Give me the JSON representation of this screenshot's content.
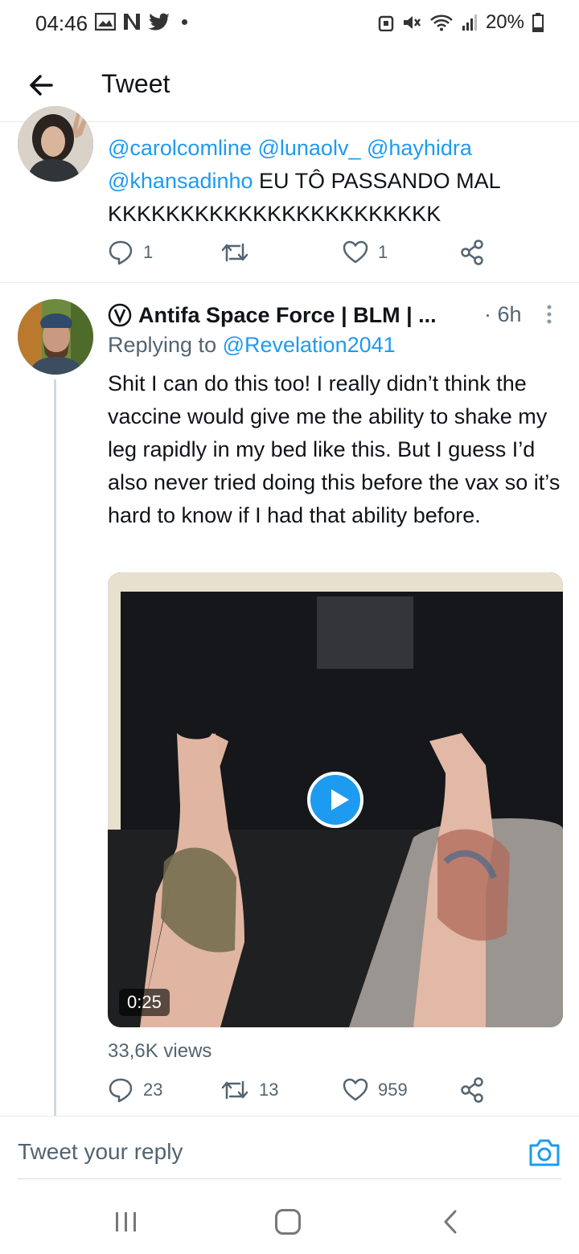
{
  "status_bar": {
    "time": "04:46",
    "battery": "20%"
  },
  "header": {
    "title": "Tweet"
  },
  "tweet1": {
    "mentions_line1": "@carolcomline @lunaolv_ @hayhidra",
    "mention_line2": "@khansadinho",
    "text_line2": " EU TÔ PASSANDO MAL",
    "text_line3": "KKKKKKKKKKKKKKKKKKKKKKK",
    "reply_count": "1",
    "like_count": "1"
  },
  "tweet2": {
    "author_name": "Antifa Space Force | BLM | ...",
    "time": "· 6h",
    "replying_prefix": "Replying to ",
    "replying_to": "@Revelation2041",
    "text": "Shit I can do this too! I really didn’t think the vaccine would give me the ability to shake my leg rapidly in my bed like this. But I guess I’d also never tried doing this before the vax so it’s hard to know if I had that ability before.",
    "video_duration": "0:25",
    "views": "33,6K views",
    "reply_count": "23",
    "retweet_count": "13",
    "like_count": "959"
  },
  "composer": {
    "placeholder": "Tweet your reply"
  },
  "colors": {
    "accent": "#1d9bf0",
    "muted": "#536471",
    "text": "#0f1419"
  }
}
